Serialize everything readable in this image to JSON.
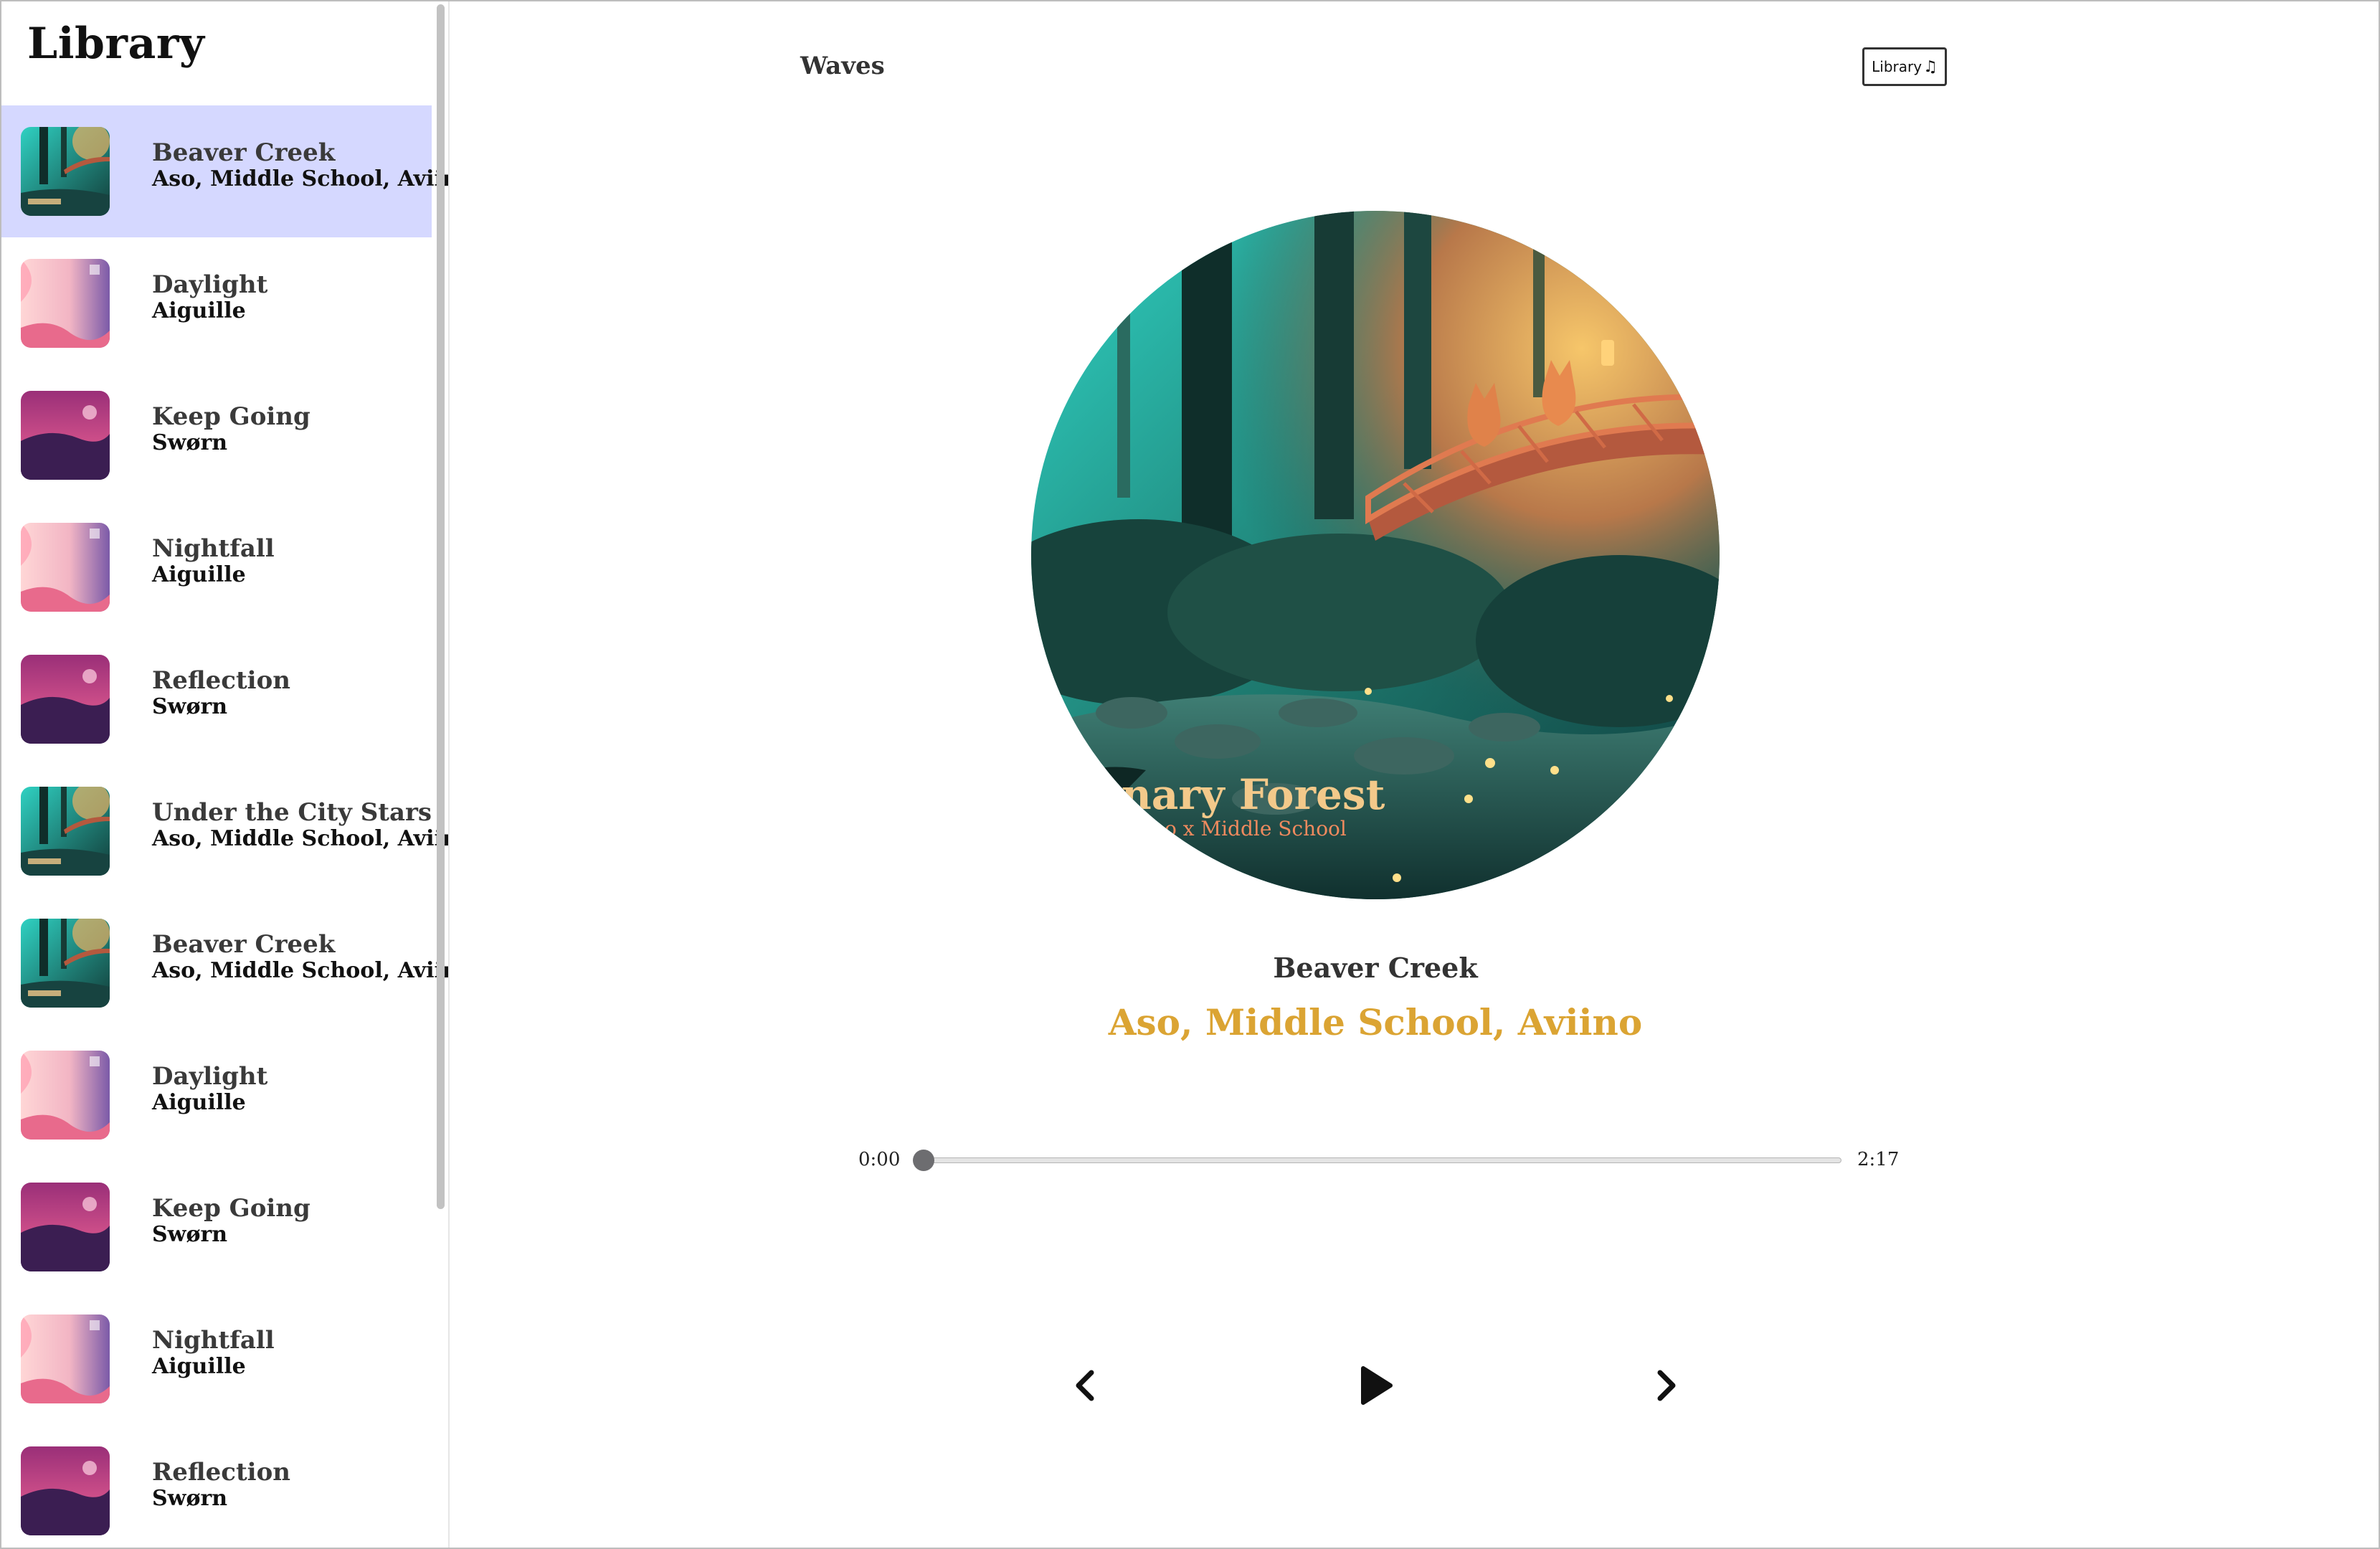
{
  "sidebar": {
    "title": "Library",
    "tracks": [
      {
        "title": "Beaver Creek",
        "artist": "Aso, Middle School, Aviino",
        "art": "forest",
        "active": true
      },
      {
        "title": "Daylight",
        "artist": "Aiguille",
        "art": "pink"
      },
      {
        "title": "Keep Going",
        "artist": "Swørn",
        "art": "magenta"
      },
      {
        "title": "Nightfall",
        "artist": "Aiguille",
        "art": "pink"
      },
      {
        "title": "Reflection",
        "artist": "Swørn",
        "art": "magenta"
      },
      {
        "title": "Under the City Stars",
        "artist": "Aso, Middle School, Aviino",
        "art": "forest"
      },
      {
        "title": "Beaver Creek",
        "artist": "Aso, Middle School, Aviino",
        "art": "forest"
      },
      {
        "title": "Daylight",
        "artist": "Aiguille",
        "art": "pink"
      },
      {
        "title": "Keep Going",
        "artist": "Swørn",
        "art": "magenta"
      },
      {
        "title": "Nightfall",
        "artist": "Aiguille",
        "art": "pink"
      },
      {
        "title": "Reflection",
        "artist": "Swørn",
        "art": "magenta"
      }
    ]
  },
  "header": {
    "app_name": "Waves",
    "library_button": "Library",
    "library_icon": "music-note-icon"
  },
  "now_playing": {
    "cover_text_line1": "anary Forest",
    "cover_text_line2": "iino x Middle School",
    "title": "Beaver Creek",
    "artist": "Aso, Middle School, Aviino"
  },
  "player": {
    "current_time": "0:00",
    "total_time": "2:17",
    "progress": 0.0,
    "prev_icon": "chevron-left-icon",
    "play_icon": "play-icon",
    "next_icon": "chevron-right-icon"
  },
  "colors": {
    "active_track_bg": "#d5d8ff",
    "artist_accent": "#dba433"
  }
}
